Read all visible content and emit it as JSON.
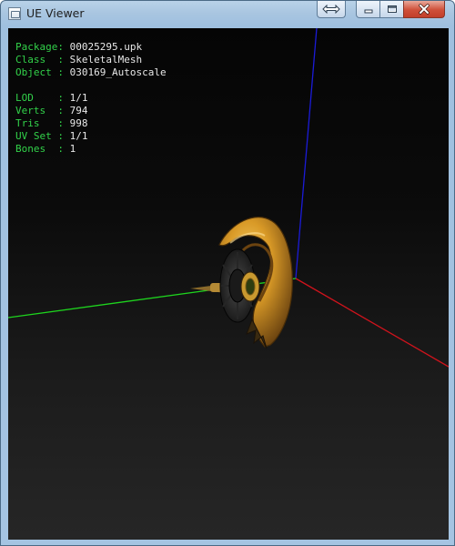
{
  "window": {
    "title": "UE Viewer",
    "buttons": {
      "resize": "resize-icon",
      "minimize": "minimize-icon",
      "maximize": "maximize-icon",
      "close": "close-icon"
    }
  },
  "info": {
    "package": {
      "label": "Package:",
      "value": "00025295.upk"
    },
    "class": {
      "label": "Class  :",
      "value": "SkeletalMesh"
    },
    "object": {
      "label": "Object :",
      "value": "030169_Autoscale"
    },
    "lod": {
      "label": "LOD    :",
      "value": "1/1"
    },
    "verts": {
      "label": "Verts  :",
      "value": "794"
    },
    "tris": {
      "label": "Tris   :",
      "value": "998"
    },
    "uvset": {
      "label": "UV Set :",
      "value": "1/1"
    },
    "bones": {
      "label": "Bones  :",
      "value": "1"
    }
  },
  "colors": {
    "label_green": "#32d24a",
    "axis_x": "#d0131c",
    "axis_y": "#1ed41e",
    "axis_z": "#1b1bd8",
    "mesh_gold": "#d89a25"
  }
}
